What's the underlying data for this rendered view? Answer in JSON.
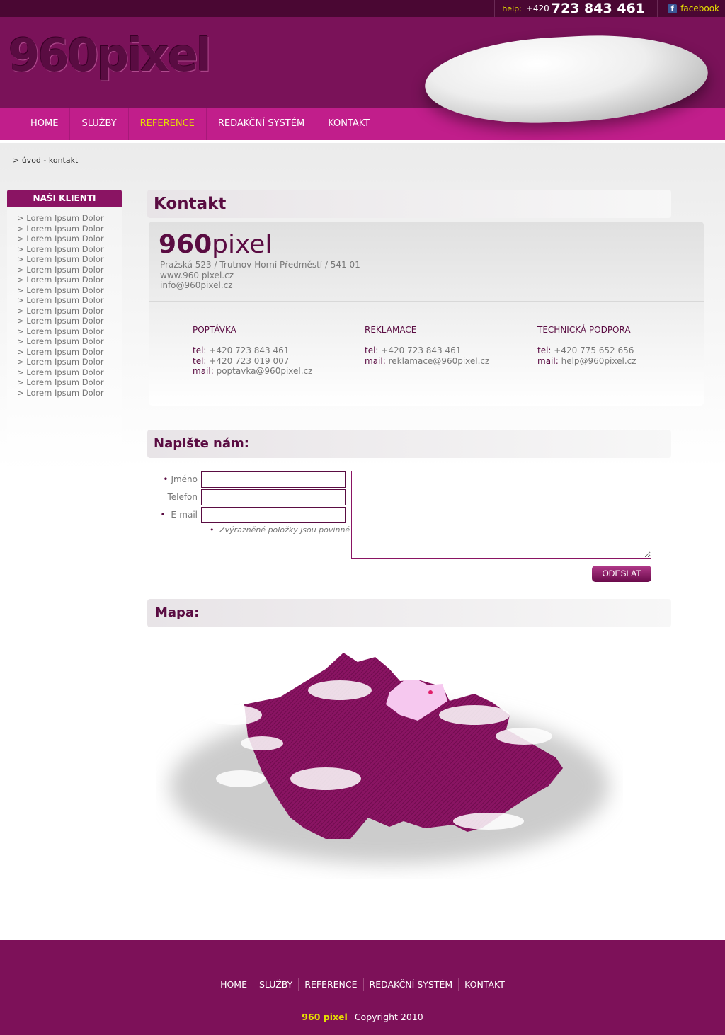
{
  "topbar": {
    "help_label": "help:",
    "phone_prefix": "+420",
    "phone": "723 843 461",
    "facebook": "facebook"
  },
  "header": {
    "logo": "960pixel"
  },
  "nav": [
    "HOME",
    "SLUŽBY",
    "REFERENCE",
    "REDAKČNÍ SYSTÉM",
    "KONTAKT"
  ],
  "nav_active": "REFERENCE",
  "breadcrumb": "> úvod - kontakt",
  "sidebar": {
    "title": "NAŠI KLIENTI",
    "items": [
      "> Lorem Ipsum Dolor",
      "> Lorem Ipsum Dolor",
      "> Lorem Ipsum Dolor",
      "> Lorem Ipsum Dolor",
      "> Lorem Ipsum Dolor",
      "> Lorem Ipsum Dolor",
      "> Lorem Ipsum Dolor",
      "> Lorem Ipsum Dolor",
      "> Lorem Ipsum Dolor",
      "> Lorem Ipsum Dolor",
      "> Lorem Ipsum Dolor",
      "> Lorem Ipsum Dolor",
      "> Lorem Ipsum Dolor",
      "> Lorem Ipsum Dolor",
      "> Lorem Ipsum Dolor",
      "> Lorem Ipsum Dolor",
      "> Lorem Ipsum Dolor",
      "> Lorem Ipsum Dolor"
    ]
  },
  "contact": {
    "title": "Kontakt",
    "company_bold": "960",
    "company_rest": "pixel",
    "address": "Pražská 523  / Trutnov-Horní Předměstí  /  541 01",
    "web": "www.960 pixel.cz",
    "email": "info@960pixel.cz",
    "columns": [
      {
        "title": "POPTÁVKA",
        "lines": [
          [
            "tel:",
            "+420 723 843 461"
          ],
          [
            "tel:",
            "+420 723 019 007"
          ],
          [
            "mail:",
            "poptavka@960pixel.cz"
          ]
        ]
      },
      {
        "title": "REKLAMACE",
        "lines": [
          [
            "tel:",
            "+420 723 843 461"
          ],
          [
            "mail:",
            "reklamace@960pixel.cz"
          ]
        ]
      },
      {
        "title": "TECHNICKÁ PODPORA",
        "lines": [
          [
            "tel:",
            "+420 775 652 656"
          ],
          [
            "mail:",
            "help@960pixel.cz"
          ]
        ]
      }
    ]
  },
  "form": {
    "title": "Napište nám:",
    "name_label": "Jméno",
    "phone_label": "Telefon",
    "email_label": "E-mail",
    "required_note": "Zvýrazněné položky jsou povinné",
    "submit": "ODESLAT",
    "name_value": "",
    "phone_value": "",
    "email_value": "",
    "message_value": ""
  },
  "map": {
    "title": "Mapa:"
  },
  "footer": {
    "nav": [
      "HOME",
      "SLUŽBY",
      "REFERENCE",
      "REDAKČNÍ SYSTÉM",
      "KONTAKT"
    ],
    "brand": "960 pixel",
    "copyright": "Copyright 2010"
  },
  "colors": {
    "primary": "#5a0c42",
    "nav": "#c11e8b",
    "highlight": "#e6e000"
  }
}
